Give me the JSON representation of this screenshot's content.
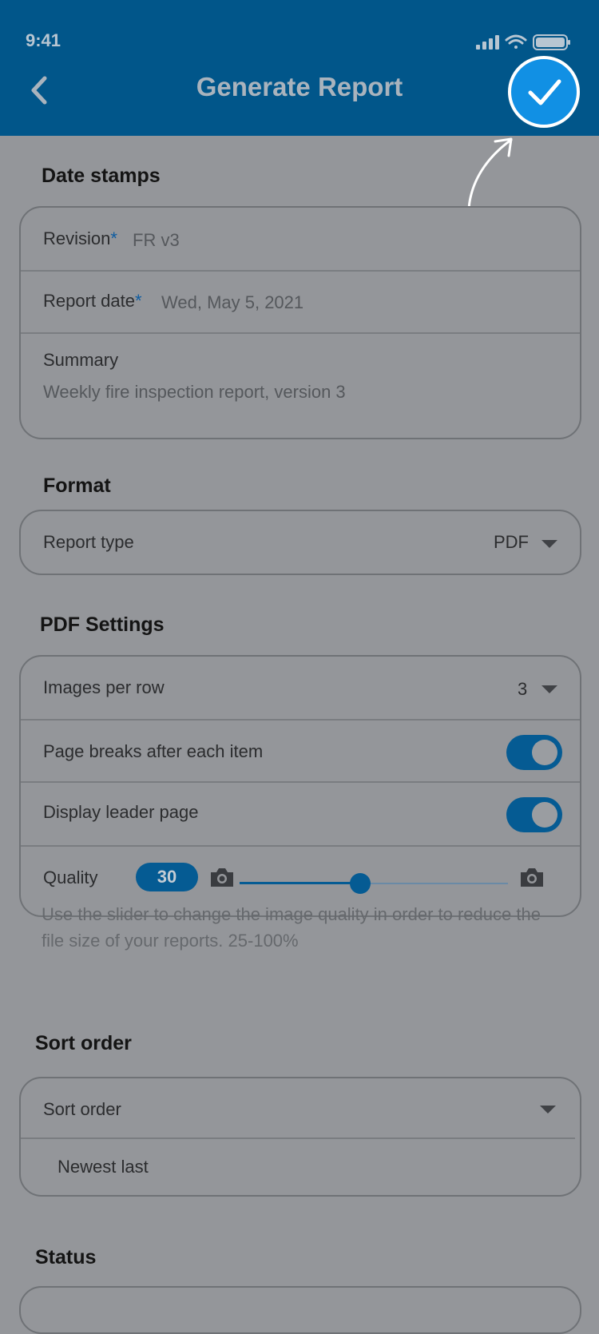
{
  "status_bar": {
    "time": "9:41"
  },
  "header": {
    "title": "Generate Report"
  },
  "colors": {
    "header_bg": "#01568a",
    "accent": "#1190e4",
    "toggle_on": "#055b93",
    "overlay_bg": "#94969a"
  },
  "icons": {
    "back": "chevron-left-icon",
    "confirm": "checkmark-icon",
    "signal": "signal-icon",
    "wifi": "wifi-icon",
    "battery": "battery-icon",
    "camera": "camera-icon",
    "caret": "caret-down-icon"
  },
  "date_stamps": {
    "title": "Date stamps",
    "revision_label": "Revision",
    "revision_value": "FR v3",
    "report_date_label": "Report date",
    "report_date_value": "Wed, May 5, 2021",
    "summary_label": "Summary",
    "summary_value": "Weekly fire inspection report, version 3",
    "required_mark": "*"
  },
  "format": {
    "title": "Format",
    "report_type_label": "Report type",
    "report_type_value": "PDF"
  },
  "pdf_settings": {
    "title": "PDF Settings",
    "images_per_row_label": "Images per row",
    "images_per_row_value": "3",
    "page_breaks_label": "Page breaks after each item",
    "page_breaks_on": true,
    "leader_page_label": "Display leader page",
    "leader_page_on": true,
    "quality_label": "Quality",
    "quality_value": "30",
    "quality_slider_fraction": 0.45,
    "hint": "Use the slider to change the image quality in order to reduce the file size of your reports. 25-100%"
  },
  "sort_order": {
    "title": "Sort order",
    "select_label": "Sort order",
    "select_value": "Newest last"
  },
  "status": {
    "title": "Status"
  }
}
